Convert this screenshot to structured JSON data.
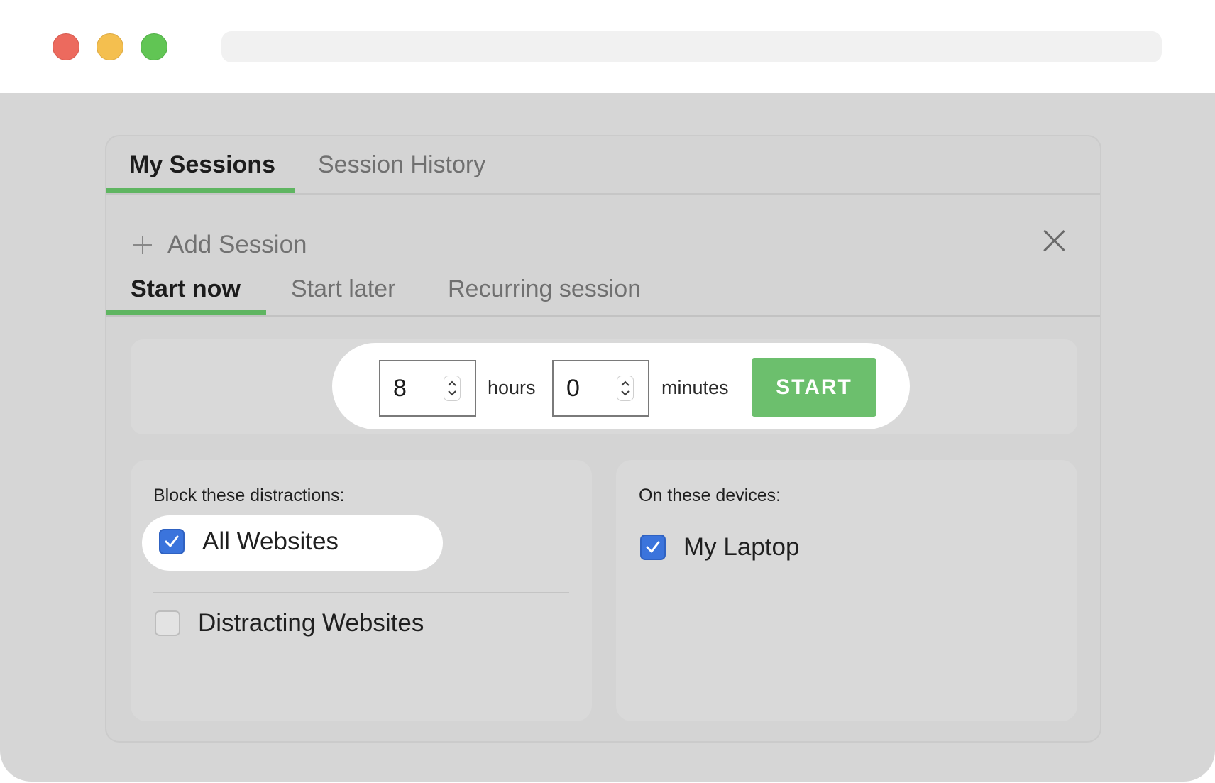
{
  "window": {
    "controls": [
      "close",
      "minimize",
      "zoom"
    ]
  },
  "tabs": {
    "items": [
      {
        "label": "My Sessions",
        "active": true
      },
      {
        "label": "Session History",
        "active": false
      }
    ]
  },
  "add_session": {
    "label": "Add Session",
    "icon": "plus-icon",
    "close_icon": "close-icon"
  },
  "session_type_tabs": {
    "items": [
      {
        "label": "Start now",
        "active": true
      },
      {
        "label": "Start later",
        "active": false
      },
      {
        "label": "Recurring session",
        "active": false
      }
    ]
  },
  "timer": {
    "hours_value": "8",
    "hours_label": "hours",
    "minutes_value": "0",
    "minutes_label": "minutes",
    "start_label": "START"
  },
  "distractions": {
    "heading": "Block these distractions:",
    "options": [
      {
        "label": "All Websites",
        "checked": true
      },
      {
        "label": "Distracting Websites",
        "checked": false
      }
    ]
  },
  "devices": {
    "heading": "On these devices:",
    "options": [
      {
        "label": "My Laptop",
        "checked": true
      }
    ]
  },
  "colors": {
    "accent_green": "#6cbf6d",
    "tab_underline": "#5fb561",
    "checkbox_blue": "#3b74dc",
    "background": "#d6d6d6"
  }
}
